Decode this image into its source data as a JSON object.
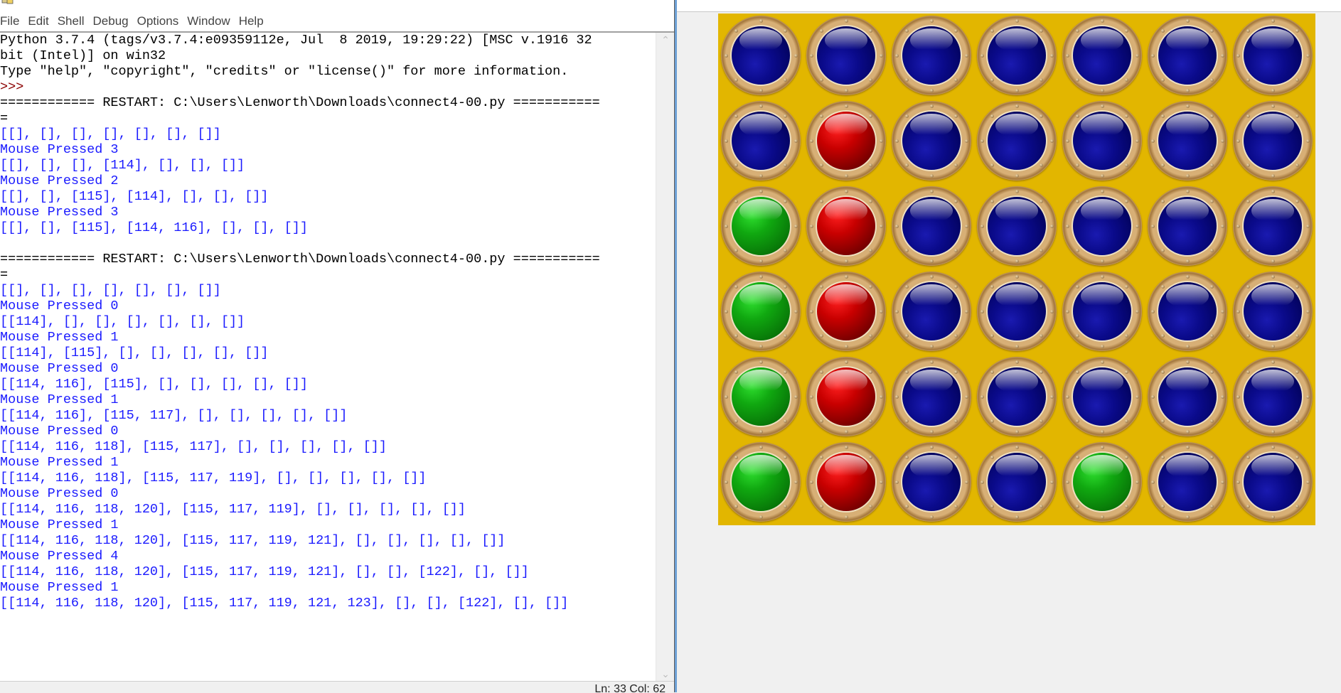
{
  "shell": {
    "title": "",
    "menu": [
      "File",
      "Edit",
      "Shell",
      "Debug",
      "Options",
      "Window",
      "Help"
    ],
    "lines": [
      {
        "text": "Python 3.7.4 (tags/v3.7.4:e09359112e, Jul  8 2019, 19:29:22) [MSC v.1916 32",
        "style": "plain"
      },
      {
        "text": "bit (Intel)] on win32",
        "style": "plain"
      },
      {
        "text": "Type \"help\", \"copyright\", \"credits\" or \"license()\" for more information.",
        "style": "plain"
      },
      {
        "text": ">>> ",
        "style": "prompt"
      },
      {
        "text": "============ RESTART: C:\\Users\\Lenworth\\Downloads\\connect4-00.py ===========",
        "style": "plain"
      },
      {
        "text": "=",
        "style": "plain"
      },
      {
        "text": "[[], [], [], [], [], [], []]",
        "style": "stdout"
      },
      {
        "text": "Mouse Pressed 3",
        "style": "stdout"
      },
      {
        "text": "[[], [], [], [114], [], [], []]",
        "style": "stdout"
      },
      {
        "text": "Mouse Pressed 2",
        "style": "stdout"
      },
      {
        "text": "[[], [], [115], [114], [], [], []]",
        "style": "stdout"
      },
      {
        "text": "Mouse Pressed 3",
        "style": "stdout"
      },
      {
        "text": "[[], [], [115], [114, 116], [], [], []]",
        "style": "stdout"
      },
      {
        "text": "",
        "style": "plain"
      },
      {
        "text": "============ RESTART: C:\\Users\\Lenworth\\Downloads\\connect4-00.py ===========",
        "style": "plain"
      },
      {
        "text": "=",
        "style": "plain"
      },
      {
        "text": "[[], [], [], [], [], [], []]",
        "style": "stdout"
      },
      {
        "text": "Mouse Pressed 0",
        "style": "stdout"
      },
      {
        "text": "[[114], [], [], [], [], [], []]",
        "style": "stdout"
      },
      {
        "text": "Mouse Pressed 1",
        "style": "stdout"
      },
      {
        "text": "[[114], [115], [], [], [], [], []]",
        "style": "stdout"
      },
      {
        "text": "Mouse Pressed 0",
        "style": "stdout"
      },
      {
        "text": "[[114, 116], [115], [], [], [], [], []]",
        "style": "stdout"
      },
      {
        "text": "Mouse Pressed 1",
        "style": "stdout"
      },
      {
        "text": "[[114, 116], [115, 117], [], [], [], [], []]",
        "style": "stdout"
      },
      {
        "text": "Mouse Pressed 0",
        "style": "stdout"
      },
      {
        "text": "[[114, 116, 118], [115, 117], [], [], [], [], []]",
        "style": "stdout"
      },
      {
        "text": "Mouse Pressed 1",
        "style": "stdout"
      },
      {
        "text": "[[114, 116, 118], [115, 117, 119], [], [], [], [], []]",
        "style": "stdout"
      },
      {
        "text": "Mouse Pressed 0",
        "style": "stdout"
      },
      {
        "text": "[[114, 116, 118, 120], [115, 117, 119], [], [], [], [], []]",
        "style": "stdout"
      },
      {
        "text": "Mouse Pressed 1",
        "style": "stdout"
      },
      {
        "text": "[[114, 116, 118, 120], [115, 117, 119, 121], [], [], [], [], []]",
        "style": "stdout"
      },
      {
        "text": "Mouse Pressed 4",
        "style": "stdout"
      },
      {
        "text": "[[114, 116, 118, 120], [115, 117, 119, 121], [], [], [122], [], []]",
        "style": "stdout"
      },
      {
        "text": "Mouse Pressed 1",
        "style": "stdout"
      },
      {
        "text": "[[114, 116, 118, 120], [115, 117, 119, 121, 123], [], [], [122], [], []]",
        "style": "stdout"
      }
    ],
    "status": "Ln: 33  Col: 62",
    "colors": {
      "stdout": "#1a1aff",
      "prompt": "#8b0000",
      "plain": "#000000"
    }
  },
  "game": {
    "title": "",
    "board": {
      "columns": 7,
      "rows": 6,
      "background": "#e2b600",
      "cells": [
        [
          "blue",
          "blue",
          "blue",
          "blue",
          "blue",
          "blue",
          "blue"
        ],
        [
          "blue",
          "red",
          "blue",
          "blue",
          "blue",
          "blue",
          "blue"
        ],
        [
          "green",
          "red",
          "blue",
          "blue",
          "blue",
          "blue",
          "blue"
        ],
        [
          "green",
          "red",
          "blue",
          "blue",
          "blue",
          "blue",
          "blue"
        ],
        [
          "green",
          "red",
          "blue",
          "blue",
          "blue",
          "blue",
          "blue"
        ],
        [
          "green",
          "red",
          "blue",
          "blue",
          "green",
          "blue",
          "blue"
        ]
      ]
    }
  }
}
